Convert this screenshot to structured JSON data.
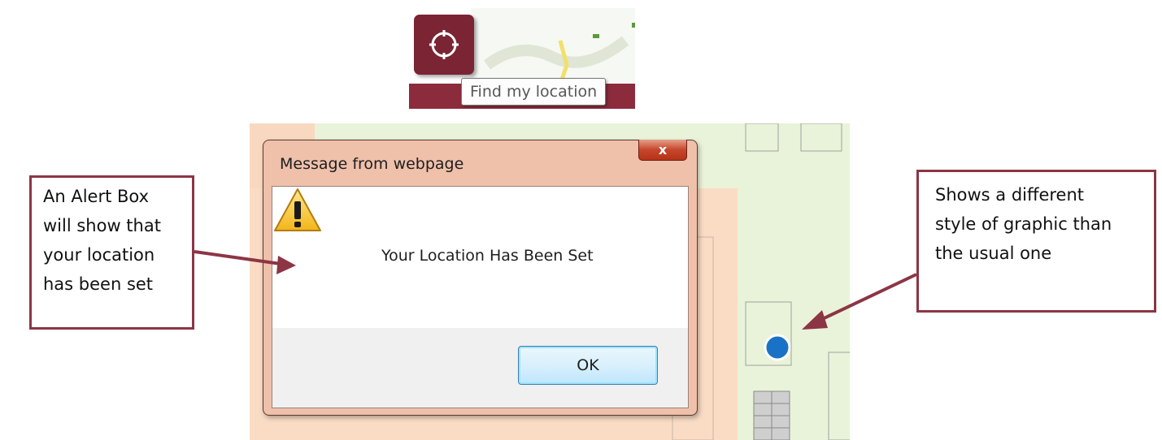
{
  "locate_control": {
    "button_icon": "crosshair-icon",
    "tooltip": "Find my location"
  },
  "alert": {
    "title": "Message from webpage",
    "close_label": "x",
    "message": "Your Location Has Been Set",
    "icon": "warning-icon",
    "ok_label": "OK"
  },
  "callouts": {
    "left": "An Alert Box\nwill show that\nyour location\nhas been set",
    "right": "Shows a different\nstyle of graphic than\nthe usual one"
  },
  "map": {
    "location_marker_color": "#1a72c6"
  },
  "colors": {
    "brand": "#7a2434",
    "callout_border": "#8c3544",
    "map_green": "#e9f3d9",
    "map_building": "#fadcc5"
  }
}
